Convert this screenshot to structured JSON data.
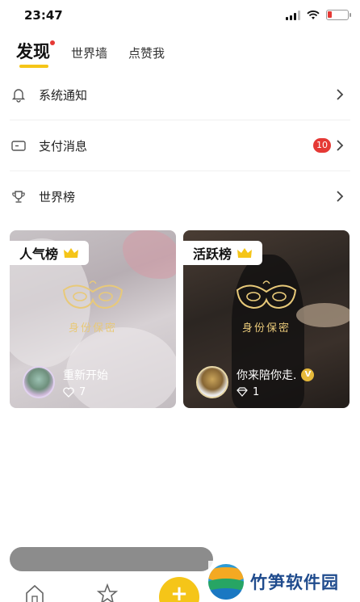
{
  "status_bar": {
    "time": "23:47"
  },
  "tabs": [
    {
      "label": "发现",
      "active": true
    },
    {
      "label": "世界墙",
      "active": false
    },
    {
      "label": "点赞我",
      "active": false
    }
  ],
  "menu": [
    {
      "label": "系统通知",
      "icon": "bell-icon"
    },
    {
      "label": "支付消息",
      "icon": "wallet-icon",
      "badge": "10"
    },
    {
      "label": "世界榜",
      "icon": "trophy-icon"
    }
  ],
  "cards": [
    {
      "tag": "人气榜",
      "mask_text": "身份保密",
      "user_name": "重新开始",
      "stat_icon": "heart-icon",
      "stat_value": "7"
    },
    {
      "tag": "活跃榜",
      "mask_text": "身份保密",
      "user_name": "你来陪你走.",
      "stat_icon": "diamond-icon",
      "stat_value": "1",
      "vip_badge": "V"
    }
  ],
  "bottom_nav": {
    "plus_label": "+"
  },
  "watermark": {
    "text": "竹笋软件园"
  },
  "colors": {
    "accent": "#f5c518",
    "badge": "#e53935",
    "mask_gold": "#e8c979"
  }
}
